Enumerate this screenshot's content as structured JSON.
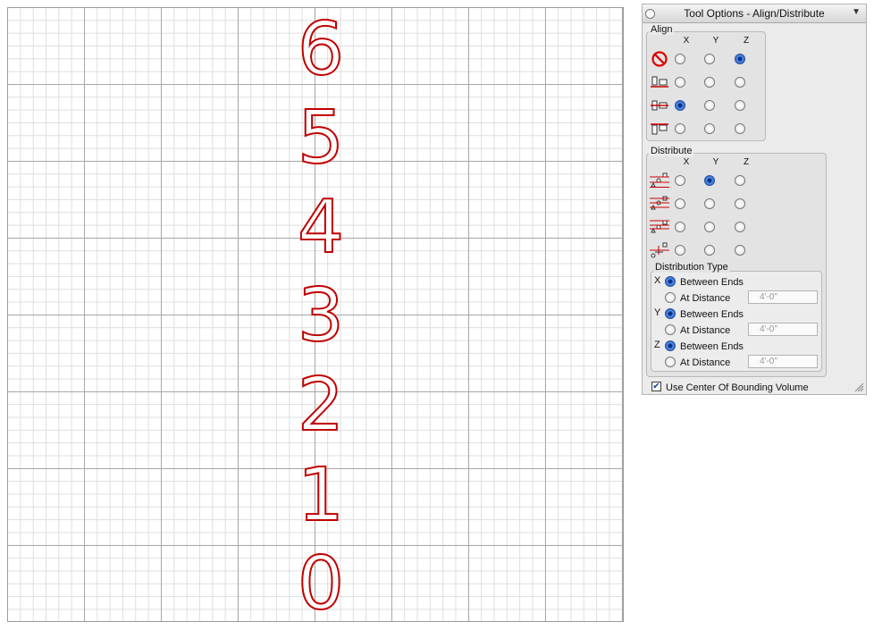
{
  "canvas": {
    "digits": [
      "6",
      "5",
      "4",
      "3",
      "2",
      "1",
      "0"
    ]
  },
  "panel": {
    "title": "Tool Options - Align/Distribute",
    "align": {
      "label": "Align",
      "cols": [
        "X",
        "Y",
        "Z"
      ],
      "rows": [
        {
          "icon": "no-align-icon",
          "selected": "Z"
        },
        {
          "icon": "align-min-icon",
          "selected": ""
        },
        {
          "icon": "align-center-icon",
          "selected": "X"
        },
        {
          "icon": "align-max-icon",
          "selected": ""
        }
      ]
    },
    "distribute": {
      "label": "Distribute",
      "cols": [
        "X",
        "Y",
        "Z"
      ],
      "rows": [
        {
          "icon": "distribute-min-icon",
          "selected": "Y"
        },
        {
          "icon": "distribute-center-icon",
          "selected": ""
        },
        {
          "icon": "distribute-max-icon",
          "selected": ""
        },
        {
          "icon": "distribute-spacing-icon",
          "selected": ""
        }
      ]
    },
    "distribution_type": {
      "label": "Distribution Type",
      "axes": [
        {
          "axis": "X",
          "between": "Between Ends",
          "at": "At Distance",
          "value": "4'-0\"",
          "selected": "between"
        },
        {
          "axis": "Y",
          "between": "Between Ends",
          "at": "At Distance",
          "value": "4'-0\"",
          "selected": "between"
        },
        {
          "axis": "Z",
          "between": "Between Ends",
          "at": "At Distance",
          "value": "4'-0\"",
          "selected": "between"
        }
      ]
    },
    "use_center": {
      "label": "Use Center Of Bounding Volume",
      "checked": true
    }
  },
  "colors": {
    "outline": "#c00000",
    "radio_selected": "#2a67cc",
    "grid_major": "#a8a8a8",
    "grid_minor": "#dedede"
  }
}
